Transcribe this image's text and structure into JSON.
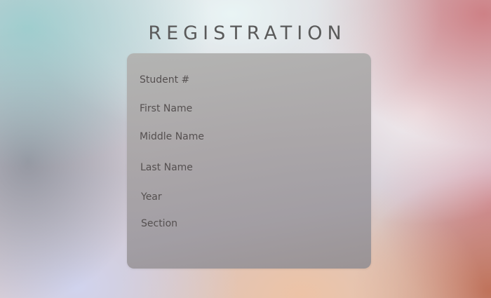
{
  "page": {
    "title": "REGISTRATION"
  },
  "form": {
    "fields": [
      {
        "label": "Student #"
      },
      {
        "label": "First Name"
      },
      {
        "label": "Middle Name"
      },
      {
        "label": "Last Name"
      },
      {
        "label": "Year"
      },
      {
        "label": "Section"
      }
    ]
  },
  "colors": {
    "title_text": "#5a5a5a",
    "label_text": "#555050",
    "card": "#aeaaab"
  }
}
